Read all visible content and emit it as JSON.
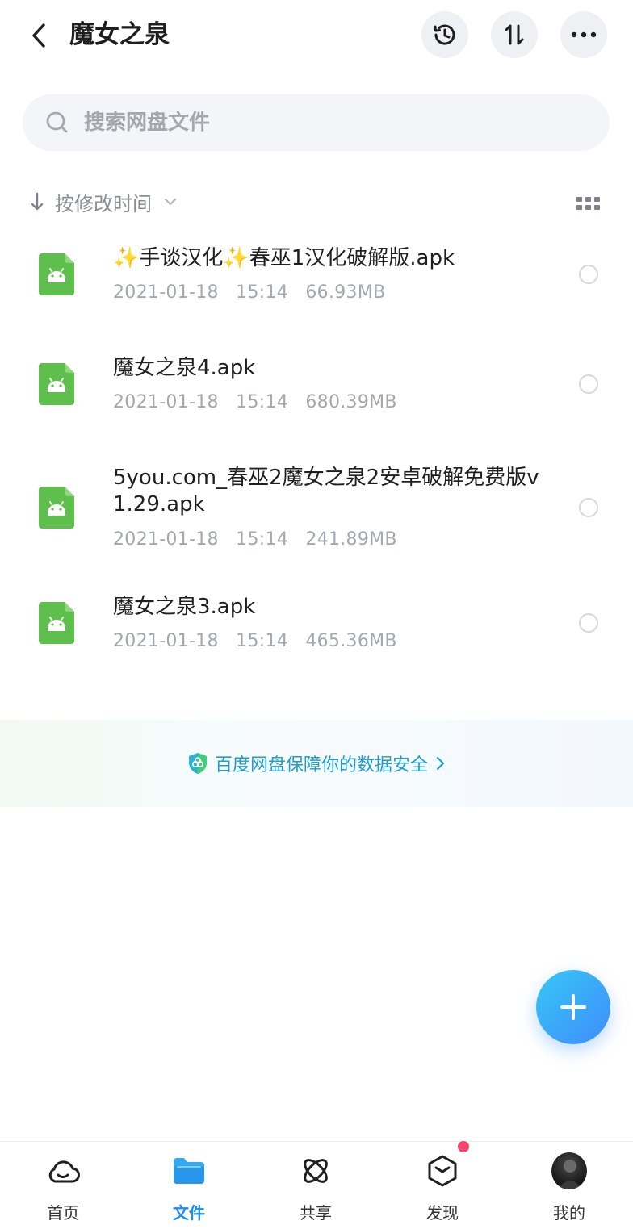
{
  "header": {
    "title": "魔女之泉"
  },
  "search": {
    "placeholder": "搜索网盘文件"
  },
  "sort": {
    "label": "按修改时间"
  },
  "files": [
    {
      "name": "✨手谈汉化✨春巫1汉化破解版.apk",
      "date": "2021-01-18",
      "time": "15:14",
      "size": "66.93MB"
    },
    {
      "name": "魔女之泉4.apk",
      "date": "2021-01-18",
      "time": "15:14",
      "size": "680.39MB"
    },
    {
      "name": "5you.com_春巫2魔女之泉2安卓破解免费版v1.29.apk",
      "date": "2021-01-18",
      "time": "15:14",
      "size": "241.89MB"
    },
    {
      "name": "魔女之泉3.apk",
      "date": "2021-01-18",
      "time": "15:14",
      "size": "465.36MB"
    }
  ],
  "banner": {
    "text": "百度网盘保障你的数据安全"
  },
  "nav": {
    "items": [
      {
        "label": "首页",
        "icon": "cloud-icon"
      },
      {
        "label": "文件",
        "icon": "folder-icon"
      },
      {
        "label": "共享",
        "icon": "share-atom-icon"
      },
      {
        "label": "发现",
        "icon": "discover-box-icon"
      },
      {
        "label": "我的",
        "icon": "avatar"
      }
    ],
    "active_index": 1
  },
  "colors": {
    "accent": "#1f8cf0",
    "apk_icon": "#5fbf4c",
    "banner_text": "#1f9ec9",
    "badge": "#f2466b"
  }
}
